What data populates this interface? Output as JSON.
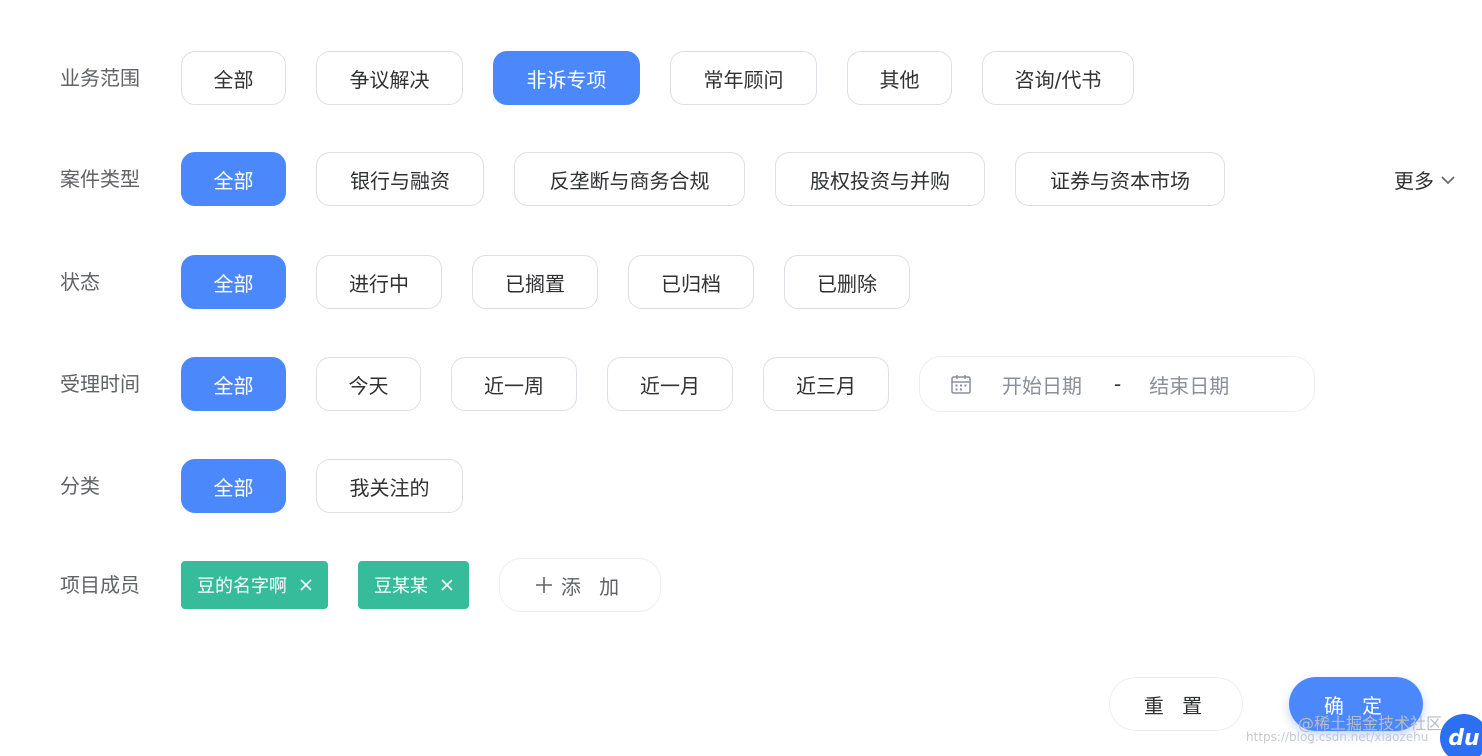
{
  "filters": {
    "business_scope": {
      "label": "业务范围",
      "options": [
        "全部",
        "争议解决",
        "非诉专项",
        "常年顾问",
        "其他",
        "咨询/代书"
      ],
      "active": "非诉专项"
    },
    "case_type": {
      "label": "案件类型",
      "options": [
        "全部",
        "银行与融资",
        "反垄断与商务合规",
        "股权投资与并购",
        "证券与资本市场"
      ],
      "active": "全部",
      "more_label": "更多"
    },
    "status": {
      "label": "状态",
      "options": [
        "全部",
        "进行中",
        "已搁置",
        "已归档",
        "已删除"
      ],
      "active": "全部"
    },
    "accept_time": {
      "label": "受理时间",
      "options": [
        "全部",
        "今天",
        "近一周",
        "近一月",
        "近三月"
      ],
      "active": "全部",
      "date_range": {
        "start_placeholder": "开始日期",
        "separator": "-",
        "end_placeholder": "结束日期"
      }
    },
    "category": {
      "label": "分类",
      "options": [
        "全部",
        "我关注的"
      ],
      "active": "全部"
    },
    "members": {
      "label": "项目成员",
      "tags": [
        "豆的名字啊",
        "豆某某"
      ],
      "add_label": "添 加"
    }
  },
  "footer": {
    "reset_label": "重 置",
    "confirm_label": "确 定"
  },
  "watermark": {
    "text": "@稀土掘金技术社区",
    "url": "https://blog.csdn.net/xiaozehu",
    "badge": "du"
  },
  "colors": {
    "primary": "#4a88fc",
    "tag": "#36bc9b",
    "border": "#dcdfe6"
  }
}
